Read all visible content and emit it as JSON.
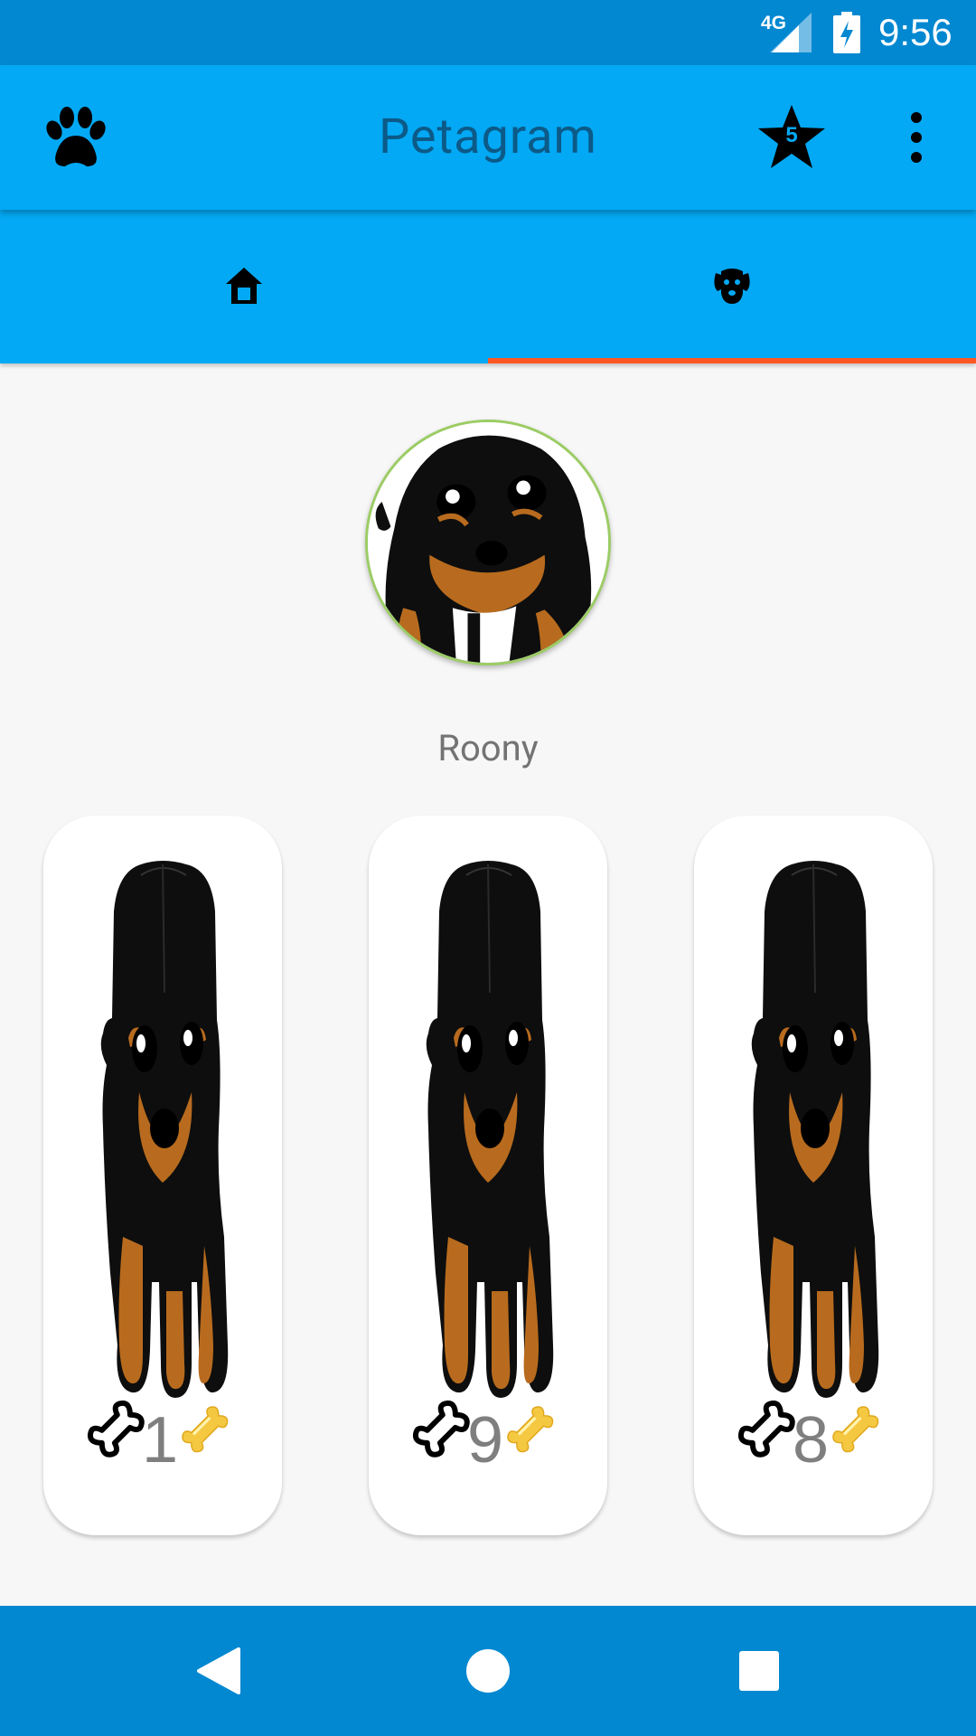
{
  "status_bar": {
    "network": "4G",
    "time": "9:56"
  },
  "app_bar": {
    "title": "Petagram",
    "favorites_count": "5"
  },
  "tabs": [
    {
      "icon": "home-icon",
      "selected": false
    },
    {
      "icon": "dog-face-icon",
      "selected": true
    }
  ],
  "profile": {
    "name": "Roony"
  },
  "photos": [
    {
      "likes": "1"
    },
    {
      "likes": "9"
    },
    {
      "likes": "8"
    }
  ],
  "colors": {
    "status_bar": "#0288d1",
    "app_bar": "#03a9f4",
    "tab_indicator": "#ff5722",
    "avatar_border": "#9ccc65"
  }
}
